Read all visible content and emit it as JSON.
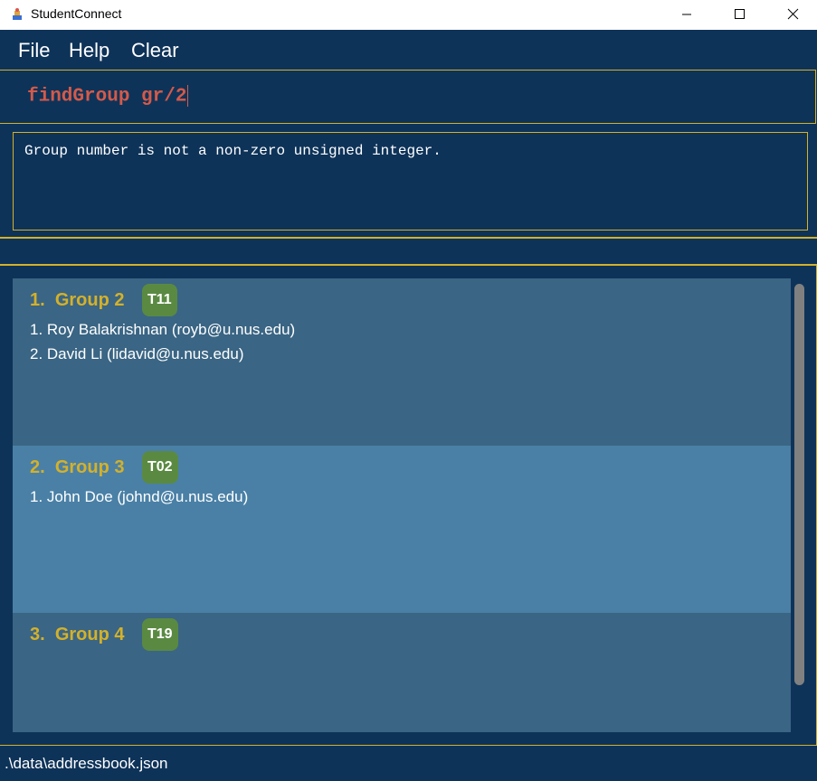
{
  "window": {
    "title": "StudentConnect",
    "icon": "app-icon"
  },
  "menu": {
    "items": [
      {
        "label": "File"
      },
      {
        "label": "Help"
      },
      {
        "label": "Clear"
      }
    ]
  },
  "command": {
    "value": "findGroup gr/2"
  },
  "result": {
    "message": "Group number is not a non-zero unsigned integer."
  },
  "groups": [
    {
      "index": "1.",
      "name": "Group 2",
      "tag": "T11",
      "members": [
        "1. Roy Balakrishnan (royb@u.nus.edu)",
        "2. David Li (lidavid@u.nus.edu)"
      ]
    },
    {
      "index": "2.",
      "name": "Group 3",
      "tag": "T02",
      "members": [
        "1. John Doe (johnd@u.nus.edu)"
      ]
    },
    {
      "index": "3.",
      "name": "Group 4",
      "tag": "T19",
      "members": []
    }
  ],
  "status": {
    "path": ".\\data\\addressbook.json"
  },
  "colors": {
    "background": "#0e3359",
    "accent_border": "#d4b12a",
    "command_text": "#d45a4a",
    "card_dark": "#3a6584",
    "card_light": "#4a80a6",
    "tag": "#5a8a42"
  }
}
